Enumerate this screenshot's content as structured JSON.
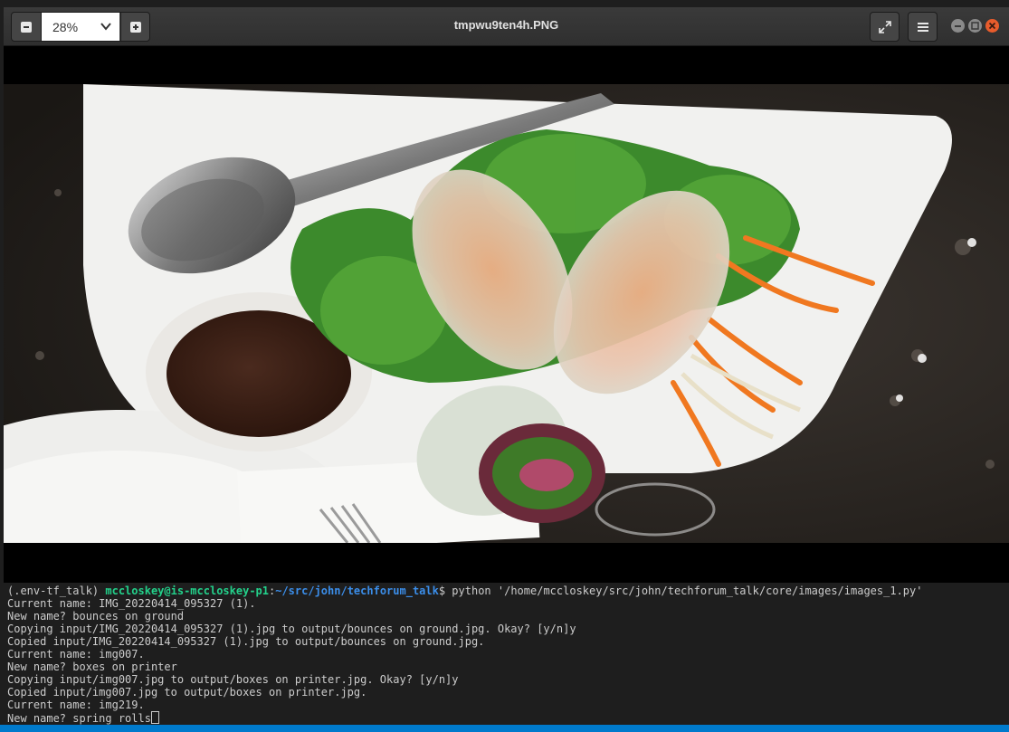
{
  "viewer": {
    "title": "tmpwu9ten4h.PNG",
    "zoom_value": "28%"
  },
  "terminal": {
    "prompt_env": "(.env-tf_talk) ",
    "prompt_user": "mccloskey@is-mccloskey-p1",
    "prompt_sep": ":",
    "prompt_path": "~/src/john/techforum_talk",
    "prompt_command": "$ python '/home/mccloskey/src/john/techforum_talk/core/images/images_1.py'",
    "lines": [
      "Current name: IMG_20220414_095327 (1).",
      "New name? bounces on ground",
      "Copying input/IMG_20220414_095327 (1).jpg to output/bounces on ground.jpg. Okay? [y/n]y",
      "Copied input/IMG_20220414_095327 (1).jpg to output/bounces on ground.jpg.",
      "Current name: img007.",
      "New name? boxes on printer",
      "Copying input/img007.jpg to output/boxes on printer.jpg. Okay? [y/n]y",
      "Copied input/img007.jpg to output/boxes on printer.jpg.",
      "Current name: img219."
    ],
    "input_line": "New name? spring rolls"
  },
  "colors": {
    "user": "#23d18b",
    "path": "#3b8eea",
    "statusbar": "#007acc"
  }
}
